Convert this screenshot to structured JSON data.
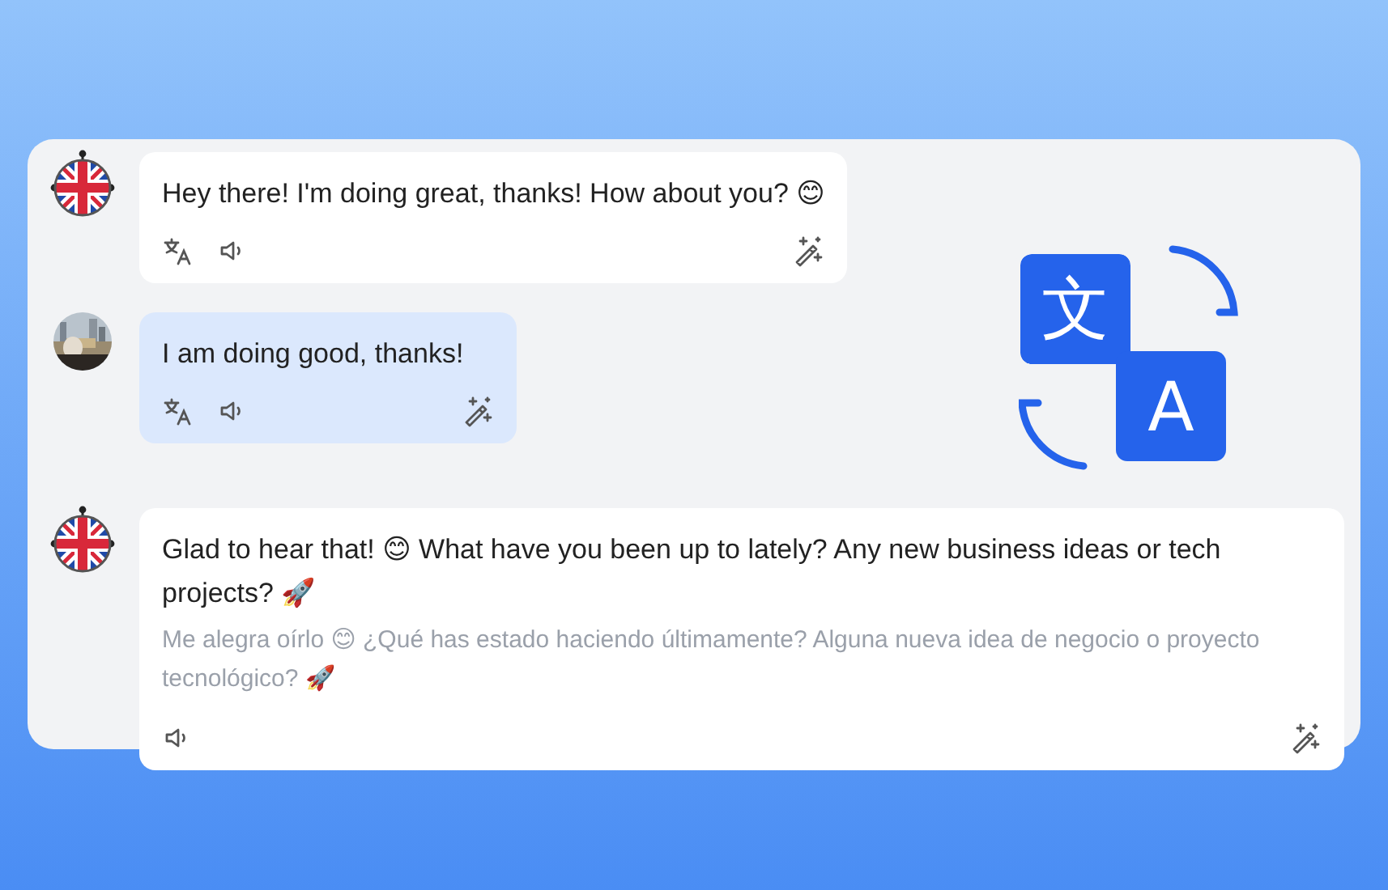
{
  "messages": [
    {
      "kind": "received",
      "avatar": {
        "kind": "flag"
      },
      "text": "Hey there! I'm doing great, thanks! How about you? 😊",
      "buttons": [
        {
          "kind": "translate"
        },
        {
          "kind": "speak"
        },
        {
          "kind": "magic"
        }
      ]
    },
    {
      "kind": "sent",
      "text": "I am doing good, thanks!",
      "buttons": [
        {
          "kind": "translate"
        },
        {
          "kind": "speak"
        },
        {
          "kind": "magic"
        }
      ]
    },
    {
      "kind": "received",
      "avatar": {
        "kind": "flag"
      },
      "text": "Glad to hear that! 😊 What have you been up to lately? Any new business ideas or tech projects? 🚀",
      "translation": "Me alegra oírlo 😊 ¿Qué has estado haciendo últimamente? Alguna nueva idea de negocio o proyecto tecnológico? 🚀",
      "buttons": [
        {
          "kind": "speak"
        },
        {
          "kind": "magic"
        }
      ]
    }
  ],
  "illustration": {
    "tiles": [
      "文",
      "A"
    ]
  }
}
